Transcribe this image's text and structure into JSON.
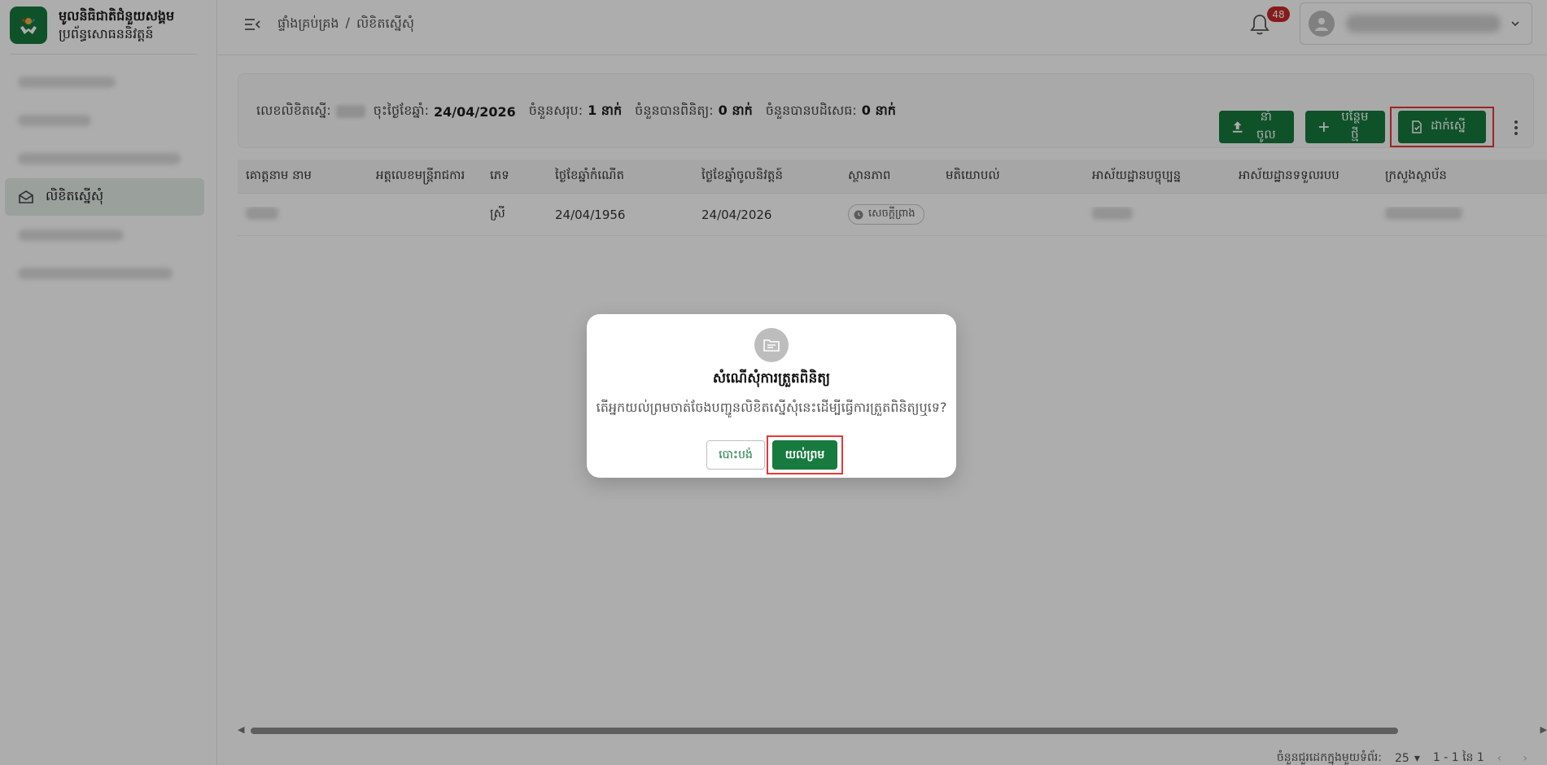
{
  "brand": {
    "title": "មូលនិធិជាតិជំនួយសង្គម",
    "subtitle": "ប្រព័ន្ធសោធននិវត្តន៍"
  },
  "sidebar": {
    "active_item": {
      "label": "លិខិតស្នើសុំ"
    }
  },
  "header": {
    "breadcrumb": [
      "ផ្ទាំងគ្រប់គ្រង",
      "/",
      "លិខិតស្នើសុំ"
    ],
    "notifications": 48
  },
  "summary": {
    "doc_label": "លេខលិខិតស្នើ:",
    "date_label": "ចុះថ្ងៃខែឆ្នាំ:",
    "date_value": "24/04/2026",
    "total_label": "ចំនួនសរុប:",
    "total_value": "1 នាក់",
    "verified_label": "ចំនួនបានពិនិត្យ:",
    "verified_value": "0 នាក់",
    "rejected_label": "ចំនួនបានបដិសេធ:",
    "rejected_value": "0 នាក់"
  },
  "toolbar": {
    "import_label": "នាំចូល",
    "add_label": "បន្ថែមថ្មី",
    "submit_label": "ដាក់ស្នើ"
  },
  "table": {
    "columns": [
      "គោត្តនាម នាម",
      "អត្តលេខមន្ត្រីរាជការ",
      "ភេទ",
      "ថ្ងៃខែឆ្នាំកំណើត",
      "ថ្ងៃខែឆ្នាំចូលនិវត្តន៍",
      "ស្ថានភាព",
      "មតិយោបល់",
      "អាស័យដ្ឋានបច្ចុប្បន្ន",
      "អាស័យដ្ឋានទទួលរបប",
      "ក្រសួងស្ថាប័ន"
    ],
    "rows": [
      {
        "sex": "ស្រី",
        "dob": "24/04/1956",
        "retire": "24/04/2026",
        "status": "សេចក្ដីព្រាង"
      }
    ]
  },
  "footer": {
    "rows_per_page_label": "ចំនួនជួរដេកក្នុងមួយទំព័រ:",
    "rows_per_page": "25",
    "range": "1 - 1 នៃ 1"
  },
  "dialog": {
    "title": "សំណើសុំការត្រួតពិនិត្យ",
    "message": "តើអ្នកយល់ព្រមចាត់ចែងបញ្ជូនលិខិតស្នើសុំនេះដើម្បីធ្វើការត្រួតពិនិត្យឬទេ?",
    "cancel_label": "បោះបង់",
    "confirm_label": "យល់ព្រម"
  },
  "colors": {
    "primary": "#177a3e",
    "highlight": "#e53935",
    "badge": "#c62828"
  }
}
